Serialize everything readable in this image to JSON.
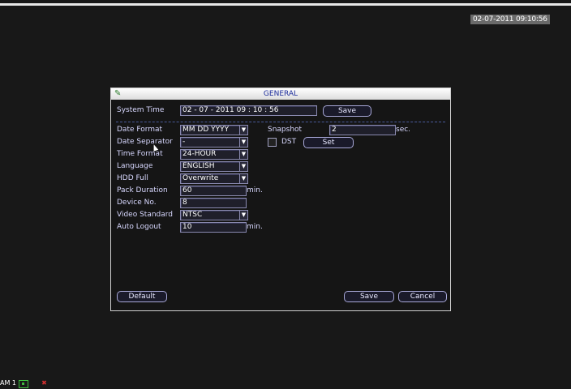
{
  "clock": "02-07-2011 09:10:56",
  "dialog": {
    "title": "GENERAL",
    "system_time_label": "System Time",
    "system_time_value": "02 - 07 - 2011   09 : 10 : 56",
    "save_time_label": "Save",
    "fields": {
      "date_format": {
        "label": "Date Format",
        "value": "MM DD YYYY"
      },
      "date_separator": {
        "label": "Date Separator",
        "value": "-"
      },
      "time_format": {
        "label": "Time Format",
        "value": "24-HOUR"
      },
      "language": {
        "label": "Language",
        "value": "ENGLISH"
      },
      "hdd_full": {
        "label": "HDD Full",
        "value": "Overwrite"
      },
      "pack_duration": {
        "label": "Pack Duration",
        "value": "60",
        "unit": "min."
      },
      "device_no": {
        "label": "Device No.",
        "value": "8"
      },
      "video_standard": {
        "label": "Video Standard",
        "value": "NTSC"
      },
      "auto_logout": {
        "label": "Auto Logout",
        "value": "10",
        "unit": "min."
      }
    },
    "snapshot": {
      "label": "Snapshot",
      "value": "2",
      "unit": "sec."
    },
    "dst": {
      "label": "DST",
      "set_label": "Set",
      "checked": false
    },
    "buttons": {
      "default": "Default",
      "save": "Save",
      "cancel": "Cancel"
    }
  },
  "status": {
    "cam_label": "AM 1"
  }
}
